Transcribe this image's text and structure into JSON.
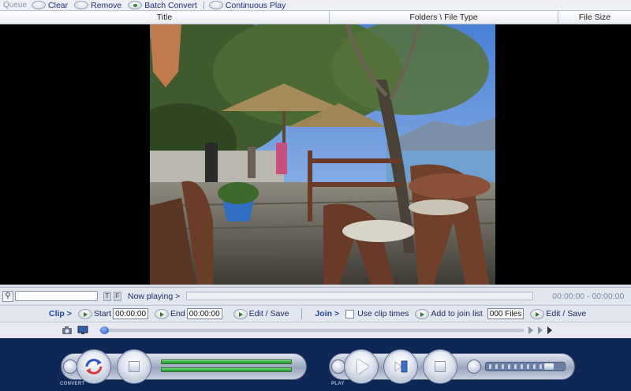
{
  "queue": {
    "label": "Queue",
    "buttons": [
      {
        "label": "Clear",
        "state": "off"
      },
      {
        "label": "Remove",
        "state": "off"
      },
      {
        "label": "Batch Convert",
        "state": "on"
      },
      {
        "label": "Continuous Play",
        "state": "off"
      }
    ]
  },
  "columns": {
    "title": "Title",
    "folders": "Folders \\ File Type",
    "size": "File Size"
  },
  "now_playing": {
    "search_icon": "search-icon",
    "toggle_t": "T",
    "toggle_f": "F",
    "label": "Now playing >",
    "time": "00:00:00 - 00:00:00"
  },
  "clip": {
    "title": "Clip >",
    "start_label": "Start",
    "start_value": "00:00:00",
    "end_label": "End",
    "end_value": "00:00:00",
    "edit_save": "Edit / Save"
  },
  "join": {
    "title": "Join >",
    "use_clip_times": "Use clip times",
    "add_to_join_list": "Add to join list",
    "files_count": "000 Files",
    "edit_save": "Edit / Save"
  },
  "controls": {
    "convert_label": "CONVERT",
    "play_label": "PLAY",
    "volume_level": 0.85
  },
  "colors": {
    "accent": "#1c46a6",
    "panel": "#0f2755",
    "progress": "#1c8f2c"
  }
}
